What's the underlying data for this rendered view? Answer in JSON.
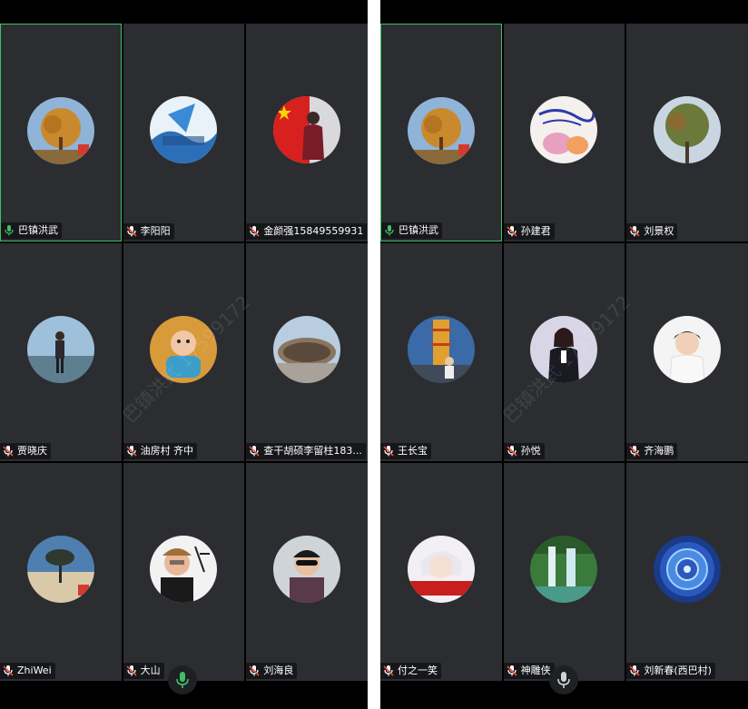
{
  "colors": {
    "active_border": "#3fbf6b",
    "tile_bg": "#2b2d30",
    "mic_active": "#3fbf6b",
    "mic_muted": "#e0533a"
  },
  "watermark": "巴镇洪武 17599172",
  "left": {
    "tiles": [
      {
        "name": "巴镇洪武",
        "mic": "mic-active-icon"
      },
      {
        "name": "李阳阳",
        "mic": "mic-muted-icon"
      },
      {
        "name": "金颜强15849559931",
        "mic": "mic-muted-icon"
      },
      {
        "name": "贾晓庆",
        "mic": "mic-muted-icon"
      },
      {
        "name": "油房村 齐中",
        "mic": "mic-muted-icon"
      },
      {
        "name": "查干胡硕李留柱183...",
        "mic": "mic-muted-icon"
      },
      {
        "name": "ZhiWei",
        "mic": "mic-muted-icon"
      },
      {
        "name": "大山",
        "mic": "mic-muted-icon"
      },
      {
        "name": "刘海良",
        "mic": "mic-muted-icon"
      }
    ]
  },
  "right": {
    "tiles": [
      {
        "name": "巴镇洪武",
        "mic": "mic-active-icon"
      },
      {
        "name": "孙建君",
        "mic": "mic-muted-icon"
      },
      {
        "name": "刘景权",
        "mic": "mic-muted-icon"
      },
      {
        "name": "王长宝",
        "mic": "mic-muted-icon"
      },
      {
        "name": "孙悦",
        "mic": "mic-muted-icon"
      },
      {
        "name": "齐海鹏",
        "mic": "mic-muted-icon"
      },
      {
        "name": "付之一笑",
        "mic": "mic-muted-icon"
      },
      {
        "name": "神雕侠",
        "mic": "mic-muted-icon"
      },
      {
        "name": "刘新春(西巴村)",
        "mic": "mic-muted-icon"
      }
    ]
  }
}
